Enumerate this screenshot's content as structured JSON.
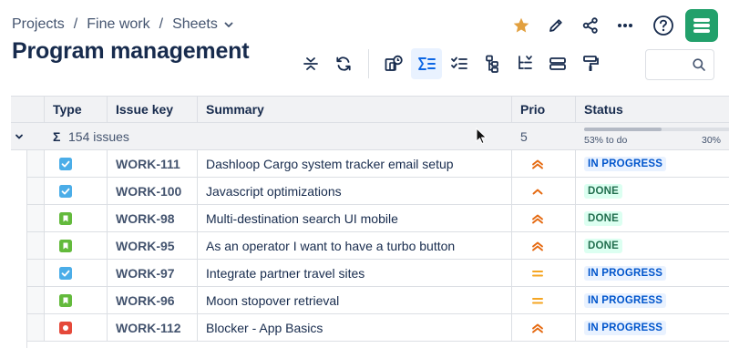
{
  "breadcrumb": {
    "items": [
      "Projects",
      "Fine work",
      "Sheets"
    ],
    "separator": "/"
  },
  "page_title": "Program management",
  "search": {
    "placeholder": ""
  },
  "columns": {
    "type": "Type",
    "key": "Issue key",
    "summary": "Summary",
    "prio": "Prio",
    "status": "Status"
  },
  "group": {
    "sigma": "Σ",
    "count_label": "154 issues",
    "prio_count": "5",
    "progress_left": "53% to do",
    "progress_right": "30%",
    "progress_fill": 0.53
  },
  "colors": {
    "accent": "#0c66e4",
    "brand": "#22a06b",
    "star": "#e2a03f",
    "prio_high": "#e56910",
    "prio_medium": "#f5a623"
  },
  "rows": [
    {
      "type": "task",
      "type_icon": "task-checkbox-icon",
      "key": "WORK-111",
      "summary": "Dashloop Cargo system tracker email setup",
      "prio": "high",
      "status": "IN PROGRESS",
      "status_kind": "prog"
    },
    {
      "type": "task",
      "type_icon": "task-checkbox-icon",
      "key": "WORK-100",
      "summary": "Javascript optimizations",
      "prio": "low-up",
      "status": "DONE",
      "status_kind": "done"
    },
    {
      "type": "story",
      "type_icon": "story-bookmark-icon",
      "key": "WORK-98",
      "summary": "Multi-destination search UI mobile",
      "prio": "high",
      "status": "DONE",
      "status_kind": "done"
    },
    {
      "type": "story",
      "type_icon": "story-bookmark-icon",
      "key": "WORK-95",
      "summary": "As an operator I want to have a turbo button",
      "prio": "high",
      "status": "DONE",
      "status_kind": "done"
    },
    {
      "type": "task",
      "type_icon": "task-checkbox-icon",
      "key": "WORK-97",
      "summary": "Integrate partner travel sites",
      "prio": "medium",
      "status": "IN PROGRESS",
      "status_kind": "prog"
    },
    {
      "type": "story",
      "type_icon": "story-bookmark-icon",
      "key": "WORK-96",
      "summary": "Moon stopover retrieval",
      "prio": "medium",
      "status": "IN PROGRESS",
      "status_kind": "prog"
    },
    {
      "type": "bug",
      "type_icon": "bug-icon",
      "key": "WORK-112",
      "summary": "Blocker - App Basics",
      "prio": "high",
      "status": "IN PROGRESS",
      "status_kind": "prog"
    }
  ]
}
